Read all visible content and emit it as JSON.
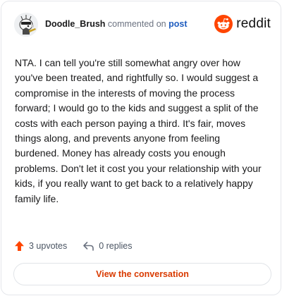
{
  "header": {
    "username": "Doodle_Brush",
    "action_text": "commented on",
    "post_link": "post",
    "brand_name": "reddit",
    "brand_color": "#ff4500"
  },
  "comment": {
    "body": "NTA. I can tell you're still somewhat angry over how you've been treated, and rightfully so. I would suggest a compromise in the interests of moving the process forward; I would go to the kids and suggest a split of the costs with each person paying a third. It's fair, moves things along, and prevents anyone from feeling burdened. Money has already costs you enough problems. Don't let it cost you your relationship with your kids, if you really want to get back to a relatively happy family life."
  },
  "stats": {
    "upvotes": "3 upvotes",
    "replies": "0 replies",
    "upvote_icon": "upvote-arrow-icon",
    "reply_icon": "reply-arrow-icon"
  },
  "cta": {
    "label": "View the conversation",
    "color": "#d93a00"
  }
}
